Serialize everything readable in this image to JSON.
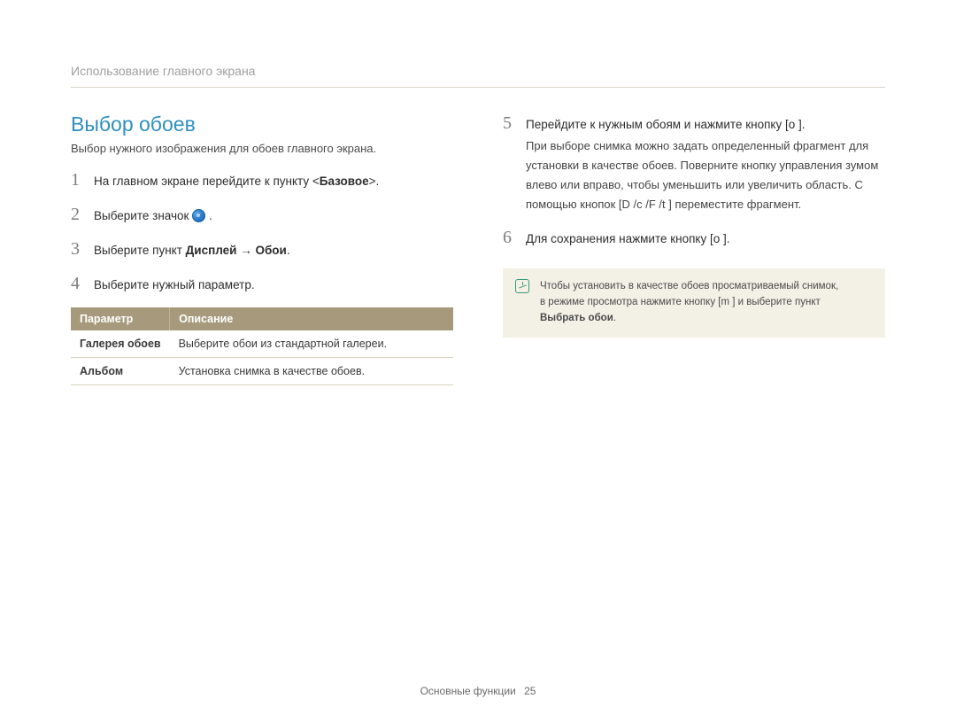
{
  "breadcrumb": "Использование главного экрана",
  "heading": "Выбор обоев",
  "intro": "Выбор нужного изображения для обоев главного экрана.",
  "steps_left": [
    {
      "num": "1",
      "text_pre": "На главном экране перейдите к пункту <",
      "bold": "Базовое",
      "text_post": ">."
    },
    {
      "num": "2",
      "text_pre": "Выберите значок ",
      "icon": true,
      "text_post": " ."
    },
    {
      "num": "3",
      "text_pre": "Выберите пункт ",
      "bold": "Дисплей → Обои",
      "text_post": "."
    },
    {
      "num": "4",
      "text_pre": "Выберите нужный параметр."
    }
  ],
  "table": {
    "header_param": "Параметр",
    "header_desc": "Описание",
    "rows": [
      {
        "k": "Галерея обоев",
        "v": "Выберите обои из стандартной галереи."
      },
      {
        "k": "Альбом",
        "v": "Установка снимка в качестве обоев."
      }
    ]
  },
  "steps_right": [
    {
      "num": "5",
      "main": "Перейдите к нужным обоям и нажмите кнопку [o    ].",
      "sub": "При выборе снимка можно задать определенный фрагмент для установки в качестве обоев. Поверните кнопку управления зумом  влево или вправо, чтобы уменьшить или увеличить область. С помощью кнопок [D     /c  /F /t    ] переместите фрагмент."
    },
    {
      "num": "6",
      "main": "Для сохранения нажмите кнопку [o    ]."
    }
  ],
  "note": {
    "line1": "Чтобы установить в качестве обоев просматриваемый снимок,",
    "line2_pre": "в режиме просмотра нажмите кнопку [m       ] и выберите пункт ",
    "line2_bold": "Выбрать обои",
    "line2_post": "."
  },
  "footer_text": "Основные функции",
  "footer_page": "25"
}
